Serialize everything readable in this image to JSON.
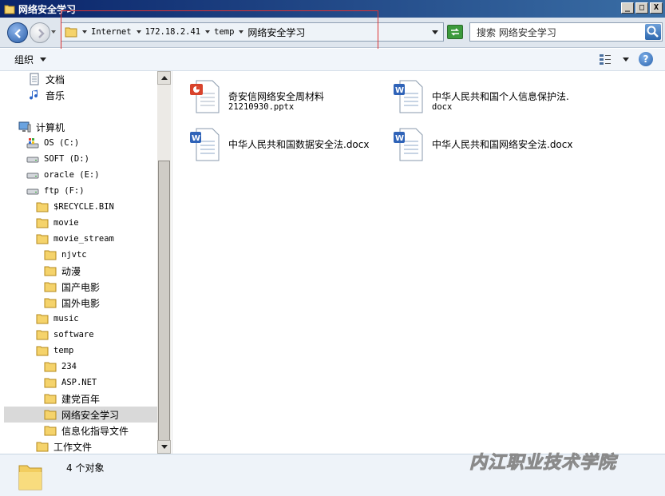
{
  "window": {
    "title": "网络安全学习",
    "controls": [
      "_",
      "□",
      "X"
    ]
  },
  "address": {
    "crumbs": [
      "Internet",
      "172.18.2.41",
      "temp",
      "网络安全学习"
    ]
  },
  "search": {
    "value": "搜索 网络安全学习"
  },
  "toolbar": {
    "organize_label": "组织"
  },
  "nav": {
    "items": [
      {
        "label": "文档",
        "icon": "documents-icon",
        "mono": false
      },
      {
        "label": "音乐",
        "icon": "music-icon",
        "mono": false
      },
      {
        "label": "计算机",
        "icon": "computer-icon",
        "mono": false
      },
      {
        "label": "OS (C:)",
        "icon": "windows-drive-icon",
        "mono": true
      },
      {
        "label": "SOFT (D:)",
        "icon": "drive-icon",
        "mono": true
      },
      {
        "label": "oracle (E:)",
        "icon": "drive-icon",
        "mono": true
      },
      {
        "label": "ftp (F:)",
        "icon": "drive-icon",
        "mono": true
      },
      {
        "label": "$RECYCLE.BIN",
        "icon": "folder-icon",
        "mono": true
      },
      {
        "label": "movie",
        "icon": "folder-icon",
        "mono": true
      },
      {
        "label": "movie_stream",
        "icon": "folder-icon",
        "mono": true
      },
      {
        "label": "njvtc",
        "icon": "folder-icon",
        "mono": true
      },
      {
        "label": "动漫",
        "icon": "folder-icon",
        "mono": false
      },
      {
        "label": "国产电影",
        "icon": "folder-icon",
        "mono": false
      },
      {
        "label": "国外电影",
        "icon": "folder-icon",
        "mono": false
      },
      {
        "label": "music",
        "icon": "folder-icon",
        "mono": true
      },
      {
        "label": "software",
        "icon": "folder-icon",
        "mono": true
      },
      {
        "label": "temp",
        "icon": "folder-icon",
        "mono": true
      },
      {
        "label": "234",
        "icon": "folder-icon",
        "mono": true
      },
      {
        "label": "ASP.NET",
        "icon": "folder-icon",
        "mono": true
      },
      {
        "label": "建党百年",
        "icon": "folder-icon",
        "mono": false
      },
      {
        "label": "网络安全学习",
        "icon": "folder-icon",
        "mono": false
      },
      {
        "label": "信息化指导文件",
        "icon": "folder-icon",
        "mono": false
      },
      {
        "label": "工作文件",
        "icon": "folder-icon",
        "mono": false
      }
    ]
  },
  "files": [
    {
      "line1": "奇安信网络安全周材料",
      "line2": "21210930.pptx",
      "icon": "powerpoint-file-icon"
    },
    {
      "line1": "中华人民共和国个人信息保护法.",
      "line2": "docx",
      "icon": "word-file-icon"
    },
    {
      "line1": "中华人民共和国数据安全法.docx",
      "line2": "",
      "icon": "word-file-icon"
    },
    {
      "line1": "中华人民共和国网络安全法.docx",
      "line2": "",
      "icon": "word-file-icon"
    }
  ],
  "status": {
    "count_text": "4 个对象"
  },
  "watermark": "内江职业技术学院",
  "colors": {
    "title_bar": "#0a246a",
    "selected_row": "#d9d9d9",
    "highlight_box": "#dd3333"
  }
}
